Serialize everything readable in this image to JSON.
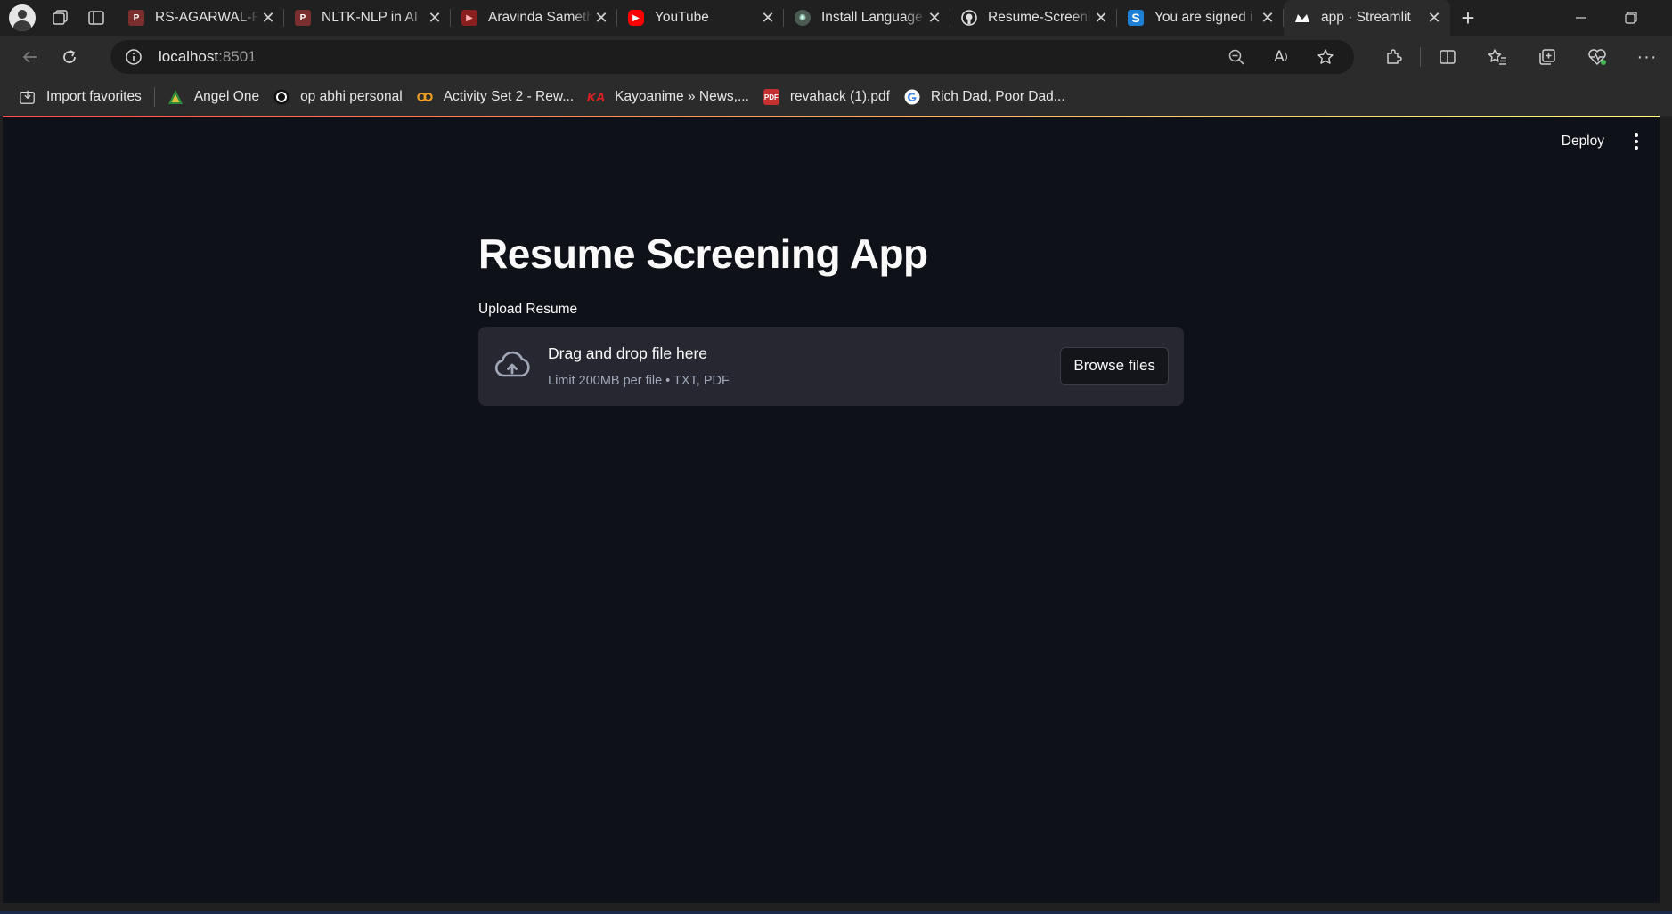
{
  "browser": {
    "tabs": [
      {
        "title": "RS-AGARWAL-F",
        "favicon": "pdf-icon"
      },
      {
        "title": "NLTK-NLP in AI",
        "favicon": "pdf-icon"
      },
      {
        "title": "Aravinda Sameth",
        "favicon": "youtube-icon"
      },
      {
        "title": "YouTube",
        "favicon": "youtube-icon"
      },
      {
        "title": "Install Language",
        "favicon": "openai-icon"
      },
      {
        "title": "Resume-Screeni",
        "favicon": "github-icon"
      },
      {
        "title": "You are signed i",
        "favicon": "s-icon"
      },
      {
        "title": "app · Streamlit",
        "favicon": "streamlit-icon",
        "active": true
      }
    ],
    "address": {
      "host": "localhost",
      "port": ":8501"
    },
    "favorites": [
      {
        "label": "Import favorites",
        "icon": "import-icon"
      },
      {
        "label": "Angel One",
        "icon": "angel-one-icon"
      },
      {
        "label": "op abhi personal",
        "icon": "op-icon"
      },
      {
        "label": "Activity Set 2 - Rew...",
        "icon": "activity-icon"
      },
      {
        "label": "Kayoanime » News,...",
        "icon": "ka-icon"
      },
      {
        "label": "revahack (1).pdf",
        "icon": "pdf-icon"
      },
      {
        "label": "Rich Dad, Poor Dad...",
        "icon": "google-icon"
      }
    ],
    "colors": {
      "frame": "#202020",
      "toolbar": "#2b2b2b",
      "page_bg": "#0e1117"
    }
  },
  "app": {
    "header": {
      "deploy_label": "Deploy"
    },
    "title": "Resume Screening App",
    "uploader": {
      "label": "Upload Resume",
      "drop_text": "Drag and drop file here",
      "limit_text": "Limit 200MB per file • TXT, PDF",
      "browse_label": "Browse files"
    },
    "colors": {
      "dropzone_bg": "#262730",
      "text": "#fafafa",
      "muted": "#a3a8b8"
    }
  }
}
